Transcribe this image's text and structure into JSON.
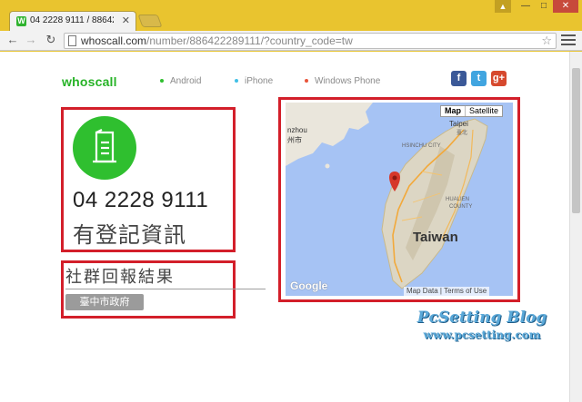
{
  "browser": {
    "tab_title": "04 2228 9111 / 886422",
    "url_host": "whoscall.com",
    "url_path": "/number/886422289111/?country_code=tw"
  },
  "site": {
    "logo": "whoscall",
    "nav": [
      {
        "label": "Android",
        "dot_color": "#2fbf2f"
      },
      {
        "label": "iPhone",
        "dot_color": "#41c0e6"
      },
      {
        "label": "Windows Phone",
        "dot_color": "#e8543a"
      }
    ],
    "social": {
      "facebook": "f",
      "twitter": "t",
      "googleplus": "g+"
    }
  },
  "info": {
    "phone_number": "04 2228 9111",
    "status": "有登記資訊",
    "icon": "note-icon"
  },
  "report": {
    "title": "社群回報結果",
    "tag": "臺中市政府"
  },
  "map": {
    "type_map": "Map",
    "type_satellite": "Satellite",
    "labels": {
      "taipei": "Taipei",
      "taipei_zh": "臺北",
      "taiwan": "Taiwan",
      "hsinchu": "HSINCHU CITY",
      "hualien": "HUALIEN",
      "hualien_county": "COUNTY",
      "fuzhou_a": "nzhou",
      "fuzhou_b": "州市"
    },
    "google": "Google",
    "footer_data": "Map Data",
    "footer_terms": "Terms of Use"
  },
  "watermark": {
    "title": "PcSetting Blog",
    "url": "www.pcsetting.com"
  }
}
